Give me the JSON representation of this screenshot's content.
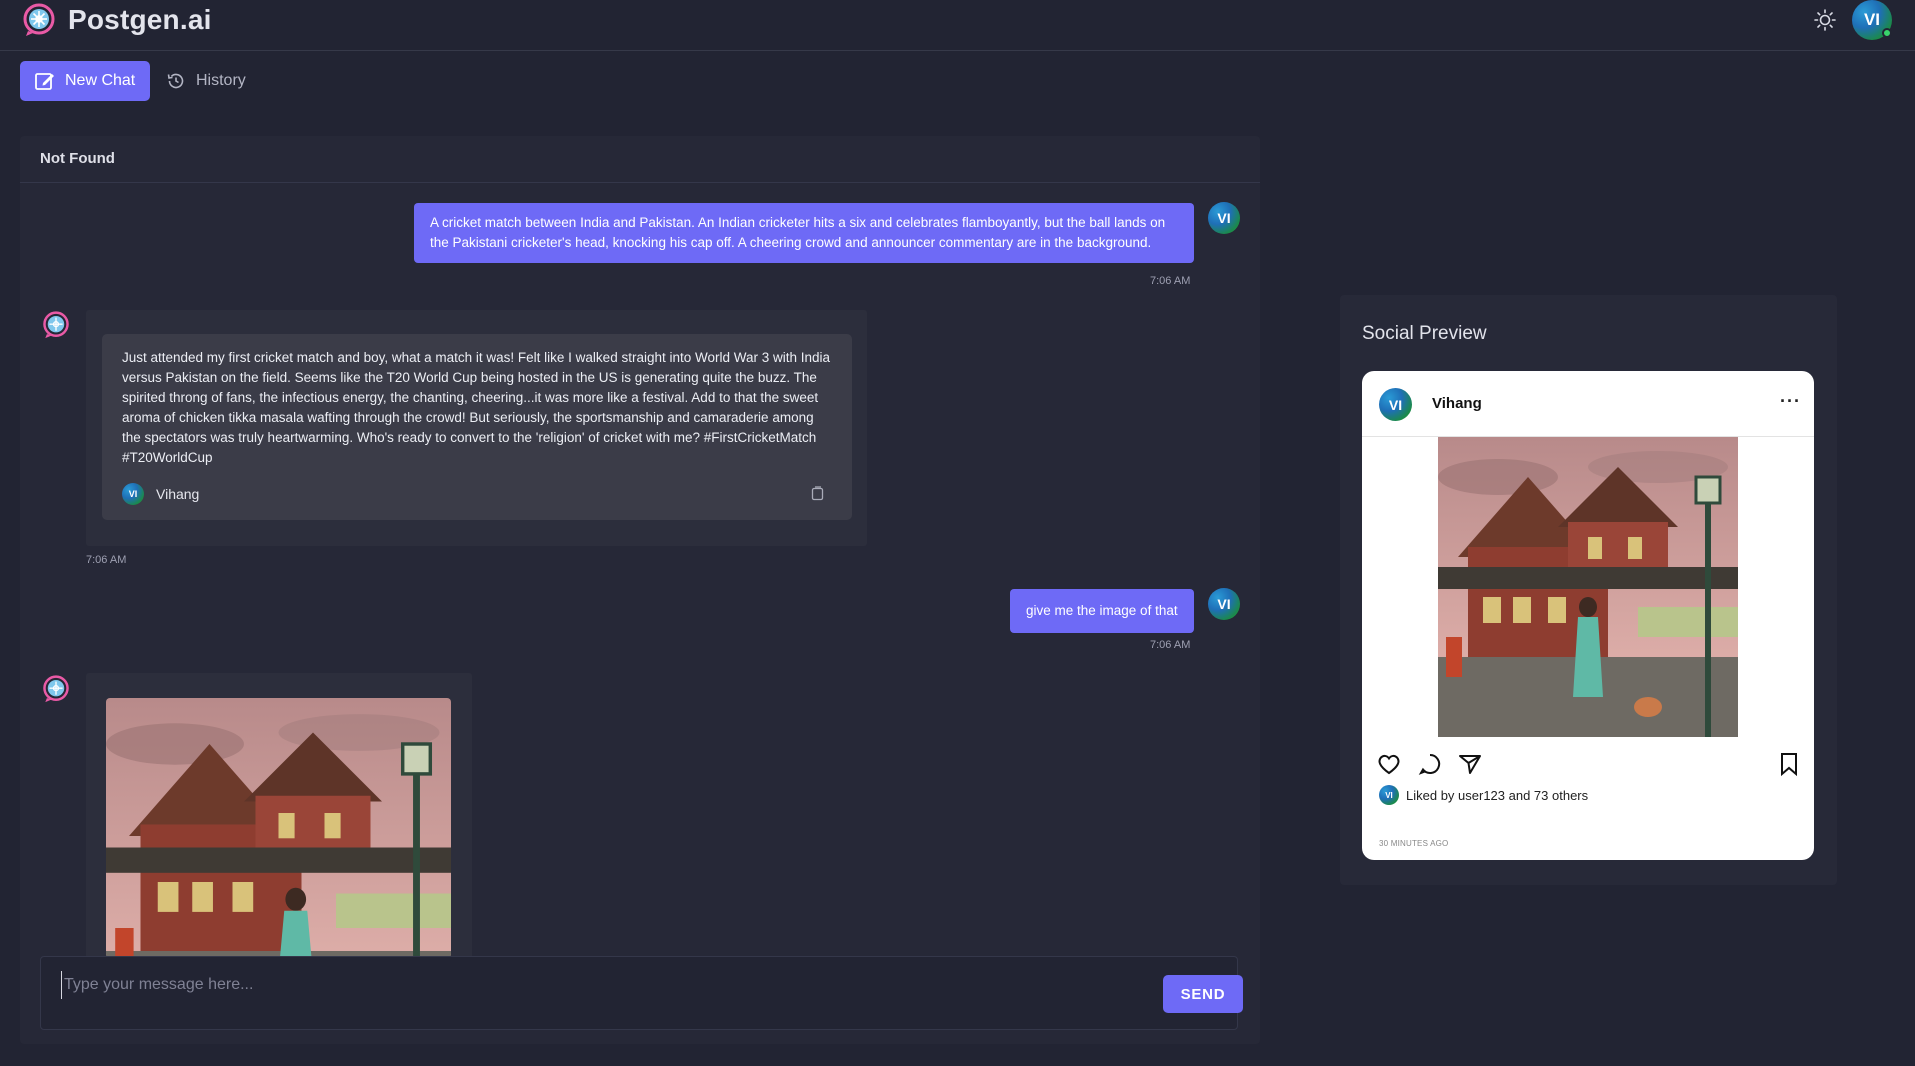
{
  "app": {
    "name": "Postgen.ai",
    "user_initials": "VI"
  },
  "nav": {
    "new_chat": "New Chat",
    "history": "History"
  },
  "chat": {
    "title": "Not Found",
    "messages": [
      {
        "role": "user",
        "text": "A cricket match between India and Pakistan. An Indian cricketer hits a six and celebrates flamboyantly, but the ball lands on the Pakistani cricketer's head, knocking his cap off. A cheering crowd and announcer commentary are in the background.",
        "time": "7:06 AM"
      },
      {
        "role": "bot",
        "text": "Just attended my first cricket match and boy, what a match it was! Felt like I walked straight into World War 3 with India versus Pakistan on the field. Seems like the T20 World Cup being hosted in the US is generating quite the buzz. The spirited throng of fans, the infectious energy, the chanting, cheering...it was more like a festival. Add to that the sweet aroma of chicken tikka masala wafting through the crowd! But seriously, the sportsmanship and camaraderie among the spectators was truly heartwarming. Who's ready to convert to the 'religion' of cricket with me? #FirstCricketMatch #T20WorldCup",
        "author": "Vihang",
        "time": "7:06 AM"
      },
      {
        "role": "user",
        "text": "give me the image of that",
        "time": "7:06 AM"
      },
      {
        "role": "bot",
        "type": "image",
        "image_desc": "railway-station-scene"
      }
    ],
    "input": {
      "placeholder": "Type your message here...",
      "value": ""
    },
    "send_label": "SEND"
  },
  "social_preview": {
    "title": "Social Preview",
    "username": "Vihang",
    "more": "···",
    "likes_text": "Liked by user123 and 73 others",
    "time": "30 MINUTES AGO"
  },
  "colors": {
    "accent": "#6e6af6",
    "background": "#222433",
    "panel": "#262837"
  }
}
